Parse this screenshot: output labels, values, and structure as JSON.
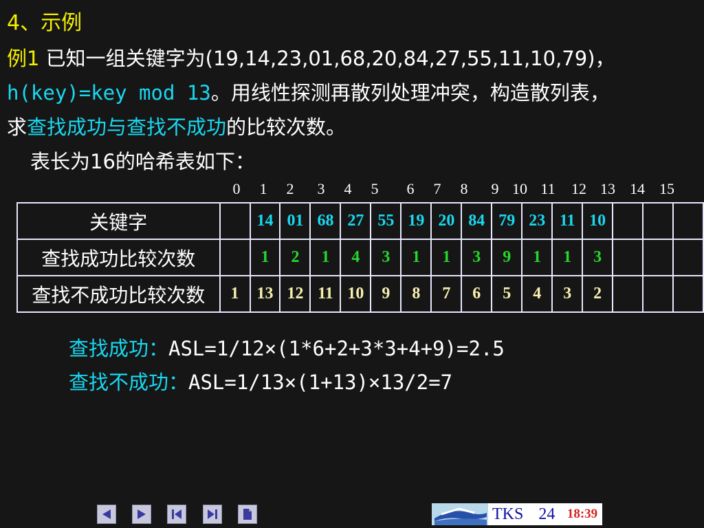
{
  "heading": "4、示例",
  "example": {
    "label": "例1",
    "line1_rest": " 已知一组关键字为(19,14,23,01,68,20,84,27,55,11,10,79)，",
    "line2_formula": "h(key)=key mod 13",
    "line2_rest": "。用线性探测再散列处理冲突，构造散列表，",
    "line3_pre": "求",
    "line3_hl1": "查找成功与查找不成功",
    "line3_rest": "的比较次数。",
    "line4": "表长为16的哈希表如下："
  },
  "indices": [
    "0",
    "1",
    "2",
    "3",
    "4",
    "5",
    "6",
    "7",
    "8",
    "9",
    "10",
    "11",
    "12",
    "13",
    "14",
    "15"
  ],
  "table": {
    "rows": [
      {
        "label": "关键字",
        "cells": [
          "",
          "14",
          "01",
          "68",
          "27",
          "55",
          "19",
          "20",
          "84",
          "79",
          "23",
          "11",
          "10",
          "",
          "",
          ""
        ]
      },
      {
        "label": "查找成功比较次数",
        "cells": [
          "",
          "1",
          "2",
          "1",
          "4",
          "3",
          "1",
          "1",
          "3",
          "9",
          "1",
          "1",
          "3",
          "",
          "",
          ""
        ]
      },
      {
        "label": "查找不成功比较次数",
        "cells": [
          "1",
          "13",
          "12",
          "11",
          "10",
          "9",
          "8",
          "7",
          "6",
          "5",
          "4",
          "3",
          "2",
          "",
          "",
          ""
        ]
      }
    ]
  },
  "asl": {
    "success_label": "查找成功：",
    "success_formula": "ASL=1/12×(1*6+2+3*3+4+9)=2.5",
    "fail_label": "查找不成功：",
    "fail_formula": "ASL=1/13×(1+13)×13/2=7"
  },
  "footer": {
    "tks": "TKS",
    "page": "24",
    "time": "18:39"
  },
  "nav_icons": [
    "previous-slide-icon",
    "next-slide-icon",
    "first-slide-icon",
    "last-slide-icon",
    "document-icon"
  ],
  "colors": {
    "background": "#161616",
    "yellow": "#f4f000",
    "cyan": "#19d8f0",
    "green": "#26d82a",
    "cream": "#f8f0b0",
    "time_red": "#d82020"
  }
}
